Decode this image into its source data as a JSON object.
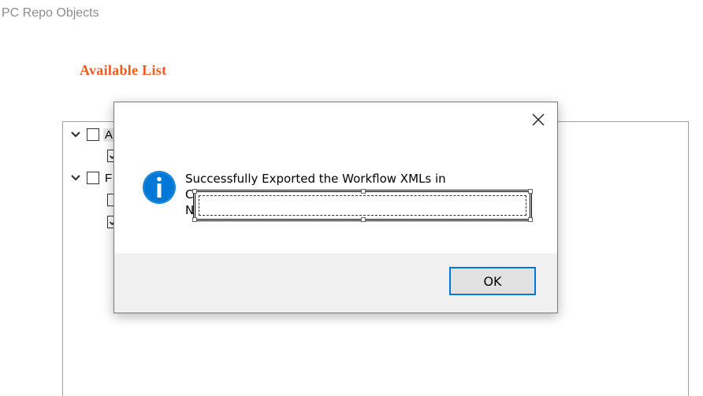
{
  "window": {
    "title": "PC Repo Objects"
  },
  "section": {
    "heading": "Available List"
  },
  "tree": {
    "items": [
      {
        "label_visible": "A",
        "expanded": true,
        "checked": false,
        "level": 0
      },
      {
        "label_visible": "",
        "checked": true,
        "level": 1
      },
      {
        "label_visible": "F",
        "expanded": true,
        "checked": false,
        "level": 0
      },
      {
        "label_visible": "",
        "checked": false,
        "level": 1
      },
      {
        "label_visible": "",
        "checked": true,
        "level": 1
      }
    ]
  },
  "dialog": {
    "message_line1": "Successfully Exported the Workflow XMLs in",
    "message_line2_visible": "C",
    "message_line3_visible": "N",
    "ok_label": "OK",
    "icon": "info-icon",
    "close_icon": "close-icon"
  },
  "colors": {
    "heading": "#f15a22",
    "info_icon": "#0078d7",
    "button_border": "#0078d7",
    "footer_bg": "#f0f0f0"
  }
}
